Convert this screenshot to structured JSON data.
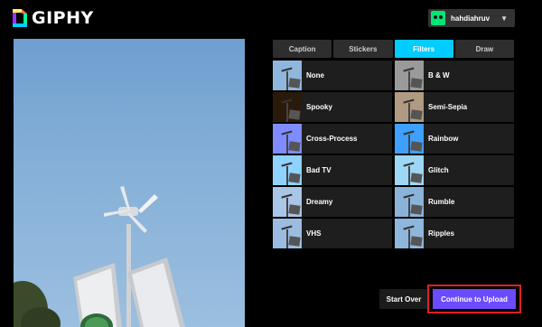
{
  "header": {
    "logo_text": "GIPHY",
    "user": {
      "name": "hahdiahruv",
      "avatar_icon": "green-face-avatar",
      "menu_icon": "chevron-down-icon"
    }
  },
  "tabs": [
    {
      "label": "Caption",
      "active": false
    },
    {
      "label": "Stickers",
      "active": false
    },
    {
      "label": "Filters",
      "active": true
    },
    {
      "label": "Draw",
      "active": false
    }
  ],
  "filters": [
    {
      "label": "None",
      "tint": "#8fb7de"
    },
    {
      "label": "B & W",
      "tint": "#9a9a9a"
    },
    {
      "label": "Spooky",
      "tint": "#2a1a0a"
    },
    {
      "label": "Semi-Sepia",
      "tint": "#b09a82"
    },
    {
      "label": "Cross-Process",
      "tint": "#7f8cff"
    },
    {
      "label": "Rainbow",
      "tint": "#3fa0ff"
    },
    {
      "label": "Bad TV",
      "tint": "#8fd2ff"
    },
    {
      "label": "Glitch",
      "tint": "#9ed6f5"
    },
    {
      "label": "Dreamy",
      "tint": "#a9c6e6"
    },
    {
      "label": "Rumble",
      "tint": "#8ab3da"
    },
    {
      "label": "VHS",
      "tint": "#9bbce0"
    },
    {
      "label": "Ripples",
      "tint": "#8fb6dc"
    }
  ],
  "actions": {
    "start_over": "Start Over",
    "continue": "Continue to Upload"
  },
  "colors": {
    "accent": "#00ccff",
    "primary_button": "#6c4bff",
    "highlight_border": "#e02020"
  }
}
